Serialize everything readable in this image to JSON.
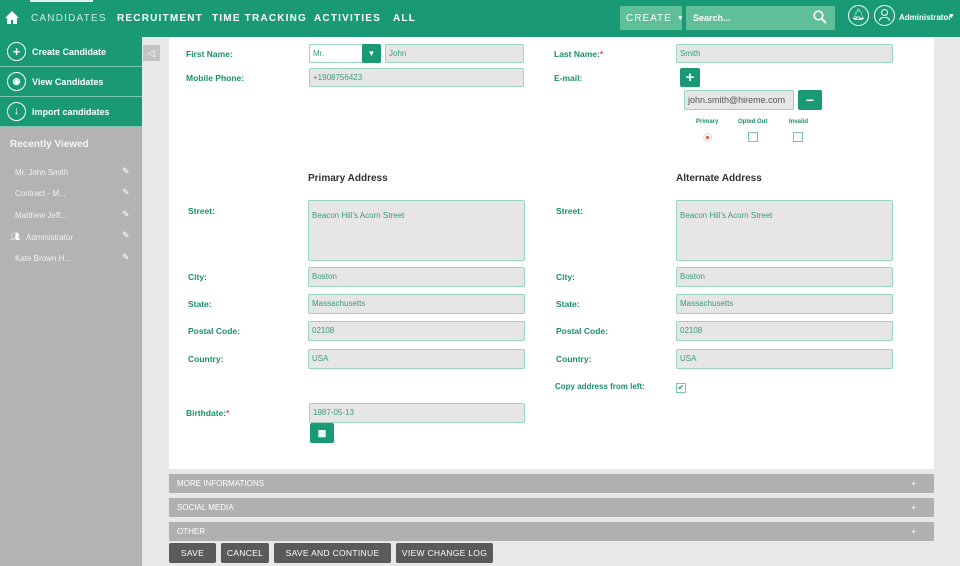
{
  "nav": {
    "items": [
      "CANDIDATES",
      "RECRUITMENT",
      "TIME TRACKING",
      "ACTIVITIES",
      "ALL"
    ],
    "create": "CREATE",
    "search_placeholder": "Search...",
    "user": "Administrator"
  },
  "sidebar": {
    "actions": [
      "Create Candidate",
      "View Candidates",
      "Import candidates"
    ],
    "recent_title": "Recently Viewed",
    "recent": [
      "Mr. John Smith",
      "Contract - M...",
      "Matthew Jeff...",
      "Administrator",
      "Kate Brown H..."
    ]
  },
  "form": {
    "first_name_label": "First Name:",
    "salutation": "Mr.",
    "first_name": "John",
    "last_name_label": "Last Name:",
    "last_name": "Smith",
    "mobile_label": "Mobile Phone:",
    "mobile": "+1908756423",
    "email_label": "E-mail:",
    "email": "john.smith@hireme.com",
    "email_flags": [
      "Primary",
      "Opted Out",
      "Invalid"
    ],
    "primary_heading": "Primary Address",
    "alternate_heading": "Alternate Address",
    "labels": {
      "street": "Street:",
      "city": "City:",
      "state": "State:",
      "postal": "Postal Code:",
      "country": "Country:"
    },
    "primary": {
      "street": "Beacon Hill's Acorn Street",
      "city": "Boston",
      "state": "Massachusetts",
      "postal": "02108",
      "country": "USA"
    },
    "alternate": {
      "street": "Beacon Hill's Acorn Street",
      "city": "Boston",
      "state": "Massachusetts",
      "postal": "02108",
      "country": "USA"
    },
    "copy_label": "Copy address from left:",
    "copy_checked": true,
    "birthdate_label": "Birthdate:",
    "birthdate": "1987-05-13"
  },
  "sections": [
    "MORE INFORMATIONS",
    "SOCIAL MEDIA",
    "OTHER"
  ],
  "footer": [
    "SAVE",
    "CANCEL",
    "SAVE AND CONTINUE",
    "VIEW CHANGE LOG"
  ],
  "colors": {
    "brand": "#1a9a74",
    "required": "#e74c3c"
  }
}
